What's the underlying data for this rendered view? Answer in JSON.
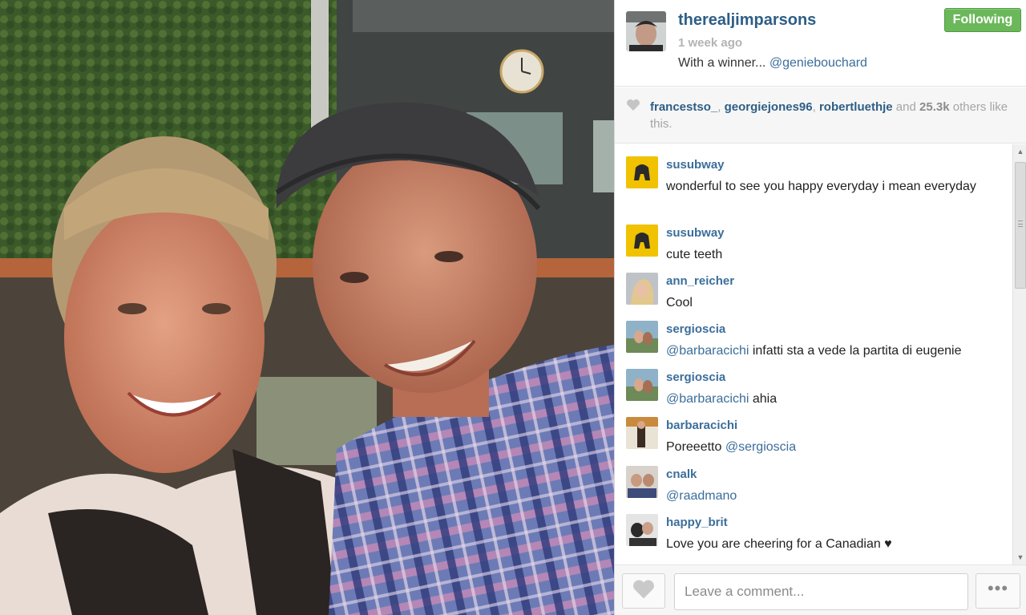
{
  "post": {
    "owner_username": "therealjimparsons",
    "time_ago": "1 week ago",
    "caption_text": "With a winner... ",
    "caption_mention": "@geniebouchard",
    "follow_label": "Following",
    "accent_color": "#6bb85a"
  },
  "likes": {
    "users": [
      "francestso_",
      "georgiejones96",
      "robertluethje"
    ],
    "and_text": " and ",
    "count": "25.3k",
    "suffix": "others like this."
  },
  "comments": [
    {
      "username": "susubway",
      "text": "wonderful to see you happy everyday i mean everyday",
      "mention": ""
    },
    {
      "username": "susubway",
      "text": "cute teeth",
      "mention": ""
    },
    {
      "username": "ann_reicher",
      "text": "Cool",
      "mention": ""
    },
    {
      "username": "sergioscia",
      "mention": "@barbaracichi",
      "text": " infatti sta a vede la partita di eugenie"
    },
    {
      "username": "sergioscia",
      "mention": "@barbaracichi",
      "text": " ahia"
    },
    {
      "username": "barbaracichi",
      "text": "Poreeetto ",
      "mention_after": "@sergioscia"
    },
    {
      "username": "cnalk",
      "mention": "@raadmano",
      "text": ""
    },
    {
      "username": "happy_brit",
      "text": "Love you are cheering for a Canadian ♥",
      "mention": ""
    }
  ],
  "footer": {
    "comment_placeholder": "Leave a comment...",
    "more_label": "•••"
  },
  "icons": {
    "like": "heart-icon",
    "more": "ellipsis-icon",
    "scroll_up": "arrow-up-icon",
    "scroll_down": "arrow-down-icon"
  }
}
